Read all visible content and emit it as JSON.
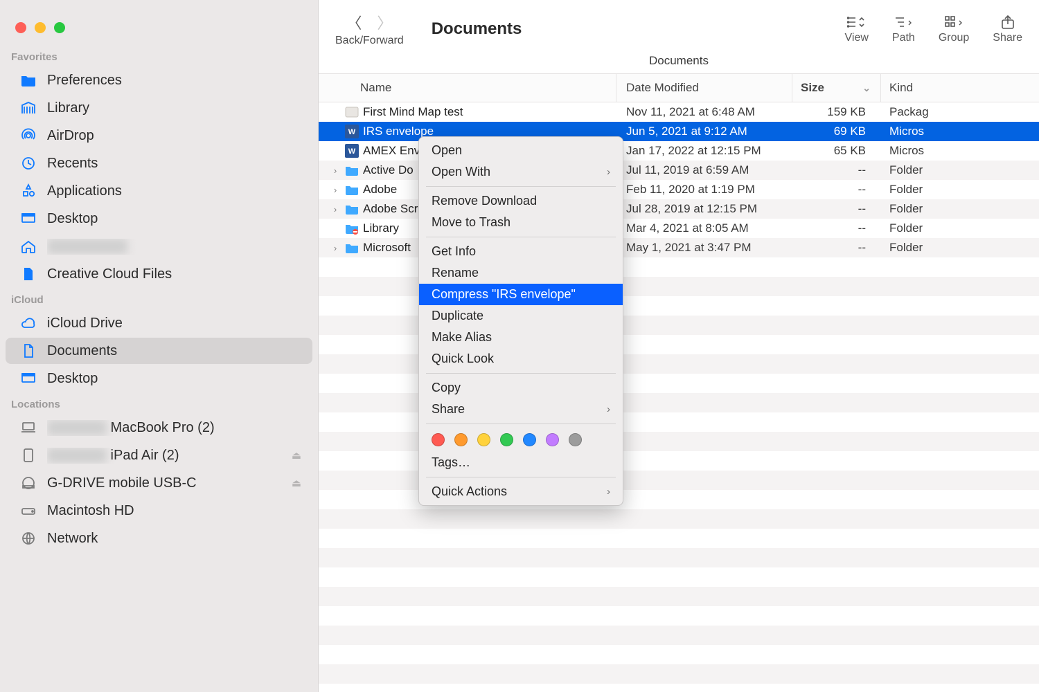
{
  "window": {
    "title": "Documents",
    "path_crumb": "Documents"
  },
  "traffic": {
    "close": "#fe5f57",
    "min": "#febc2e",
    "max": "#28c840"
  },
  "sidebar": {
    "sections": {
      "favorites_label": "Favorites",
      "icloud_label": "iCloud",
      "locations_label": "Locations"
    },
    "favorites": [
      {
        "icon": "folder",
        "label": "Preferences"
      },
      {
        "icon": "library",
        "label": "Library"
      },
      {
        "icon": "airdrop",
        "label": "AirDrop"
      },
      {
        "icon": "recents",
        "label": "Recents"
      },
      {
        "icon": "apps",
        "label": "Applications"
      },
      {
        "icon": "desktop",
        "label": "Desktop"
      },
      {
        "icon": "home",
        "label": "",
        "blur": true
      },
      {
        "icon": "file",
        "label": "Creative Cloud Files"
      }
    ],
    "icloud": [
      {
        "icon": "cloud",
        "label": "iCloud Drive"
      },
      {
        "icon": "doc",
        "label": "Documents",
        "selected": true
      },
      {
        "icon": "desktop",
        "label": "Desktop"
      }
    ],
    "locations": [
      {
        "icon": "laptop",
        "label": "MacBook Pro (2)",
        "blur_prefix": true
      },
      {
        "icon": "ipad",
        "label": "iPad Air (2)",
        "blur_prefix": true,
        "eject": true
      },
      {
        "icon": "drive",
        "label": "G-DRIVE mobile USB-C",
        "eject": true
      },
      {
        "icon": "disk",
        "label": "Macintosh HD"
      },
      {
        "icon": "network",
        "label": "Network"
      }
    ]
  },
  "toolbar": {
    "back_forward_label": "Back/Forward",
    "tools": [
      {
        "label": "View"
      },
      {
        "label": "Path"
      },
      {
        "label": "Group"
      },
      {
        "label": "Share"
      }
    ]
  },
  "columns": {
    "name": "Name",
    "date": "Date Modified",
    "size": "Size",
    "kind": "Kind"
  },
  "files": [
    {
      "icon": "mindmap",
      "name": "First Mind Map test",
      "date": "Nov 11, 2021 at 6:48 AM",
      "size": "159 KB",
      "kind": "Packag",
      "expandable": false
    },
    {
      "icon": "word",
      "name": "IRS envelope",
      "date": "Jun 5, 2021 at 9:12 AM",
      "size": "69 KB",
      "kind": "Micros",
      "selected": true
    },
    {
      "icon": "word",
      "name": "AMEX Env",
      "date": "Jan 17, 2022 at 12:15 PM",
      "size": "65 KB",
      "kind": "Micros"
    },
    {
      "icon": "folder",
      "name": "Active Do",
      "date": "Jul 11, 2019 at 6:59 AM",
      "size": "--",
      "kind": "Folder",
      "expandable": true
    },
    {
      "icon": "folder",
      "name": "Adobe",
      "date": "Feb 11, 2020 at 1:19 PM",
      "size": "--",
      "kind": "Folder",
      "expandable": true
    },
    {
      "icon": "folder",
      "name": "Adobe Scr",
      "date": "Jul 28, 2019 at 12:15 PM",
      "size": "--",
      "kind": "Folder",
      "expandable": true
    },
    {
      "icon": "libfolder",
      "name": "Library",
      "date": "Mar 4, 2021 at 8:05 AM",
      "size": "--",
      "kind": "Folder"
    },
    {
      "icon": "folder",
      "name": "Microsoft",
      "date": "May 1, 2021 at 3:47 PM",
      "size": "--",
      "kind": "Folder",
      "expandable": true
    }
  ],
  "context_menu": {
    "items": [
      {
        "label": "Open"
      },
      {
        "label": "Open With",
        "submenu": true
      },
      {
        "sep": true
      },
      {
        "label": "Remove Download"
      },
      {
        "label": "Move to Trash"
      },
      {
        "sep": true
      },
      {
        "label": "Get Info"
      },
      {
        "label": "Rename"
      },
      {
        "label": "Compress \"IRS envelope\"",
        "highlight": true
      },
      {
        "label": "Duplicate"
      },
      {
        "label": "Make Alias"
      },
      {
        "label": "Quick Look"
      },
      {
        "sep": true
      },
      {
        "label": "Copy"
      },
      {
        "label": "Share",
        "submenu": true
      },
      {
        "sep": true
      },
      {
        "tags": true
      },
      {
        "label": "Tags…"
      },
      {
        "sep": true
      },
      {
        "label": "Quick Actions",
        "submenu": true
      }
    ],
    "tag_colors": [
      "red",
      "orange",
      "yellow",
      "green",
      "blue",
      "purple",
      "gray"
    ]
  }
}
